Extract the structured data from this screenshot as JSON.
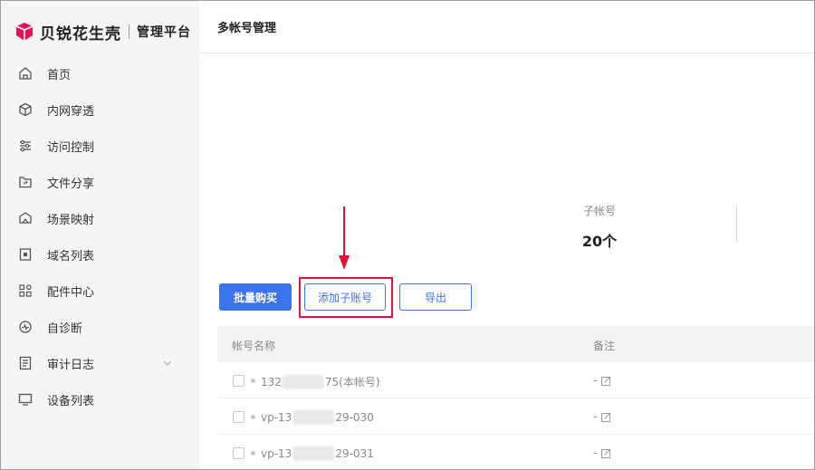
{
  "brand": {
    "name": "贝锐花生壳",
    "subtitle": "管理平台",
    "accent": "#e5105a"
  },
  "sidebar": {
    "items": [
      {
        "label": "首页",
        "icon": "home-icon"
      },
      {
        "label": "内网穿透",
        "icon": "cube-icon"
      },
      {
        "label": "访问控制",
        "icon": "sliders-icon"
      },
      {
        "label": "文件分享",
        "icon": "folder-share-icon"
      },
      {
        "label": "场景映射",
        "icon": "scene-icon"
      },
      {
        "label": "域名列表",
        "icon": "domain-icon"
      },
      {
        "label": "配件中心",
        "icon": "apps-grid-icon"
      },
      {
        "label": "自诊断",
        "icon": "diagnosis-icon"
      },
      {
        "label": "审计日志",
        "icon": "log-icon",
        "expandable": true
      },
      {
        "label": "设备列表",
        "icon": "monitor-icon"
      }
    ]
  },
  "header": {
    "title": "多帐号管理"
  },
  "stats": {
    "sub_accounts_label": "子帐号",
    "sub_accounts_value": "20个"
  },
  "toolbar": {
    "bulk_buy_label": "批量购买",
    "add_sub_account_label": "添加子账号",
    "export_label": "导出",
    "primary_color": "#3b74ef",
    "highlight_color": "#e5103a"
  },
  "table": {
    "columns": [
      "帐号名称",
      "备注"
    ],
    "rows": [
      {
        "name_prefix": "132",
        "name_suffix": "75(本帐号)",
        "note": "-"
      },
      {
        "name_prefix": "vp-13",
        "name_suffix": "29-030",
        "note": "-"
      },
      {
        "name_prefix": "vp-13",
        "name_suffix": "29-031",
        "note": "-"
      }
    ]
  }
}
